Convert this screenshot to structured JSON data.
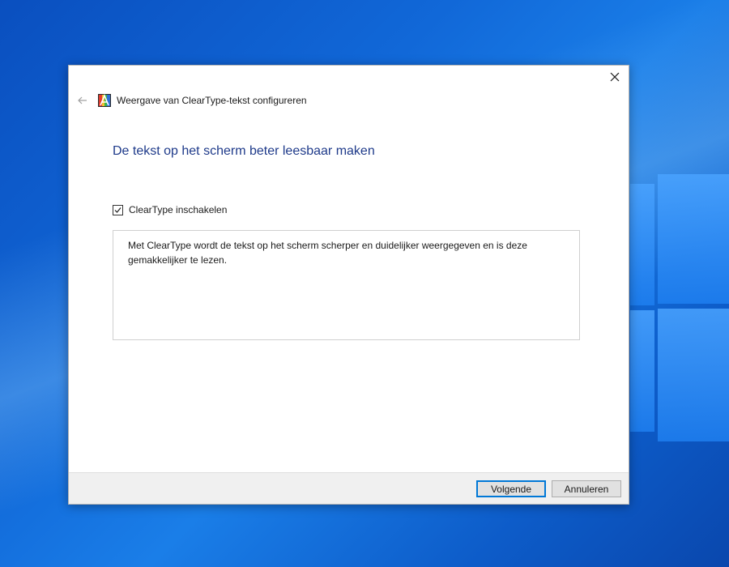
{
  "window": {
    "title": "Weergave van ClearType-tekst configureren",
    "app_icon": "cleartype-icon",
    "back_icon": "back-arrow-icon",
    "close_icon": "close-icon"
  },
  "main": {
    "heading": "De tekst op het scherm beter leesbaar maken",
    "checkbox": {
      "label": "ClearType inschakelen",
      "checked": true
    },
    "description": "Met ClearType wordt de tekst op het scherm scherper en duidelijker weergegeven en is deze gemakkelijker te lezen."
  },
  "footer": {
    "next_label": "Volgende",
    "cancel_label": "Annuleren"
  },
  "colors": {
    "heading": "#1e3a8a",
    "accent": "#0078d7",
    "desktop": "#1168d8"
  }
}
